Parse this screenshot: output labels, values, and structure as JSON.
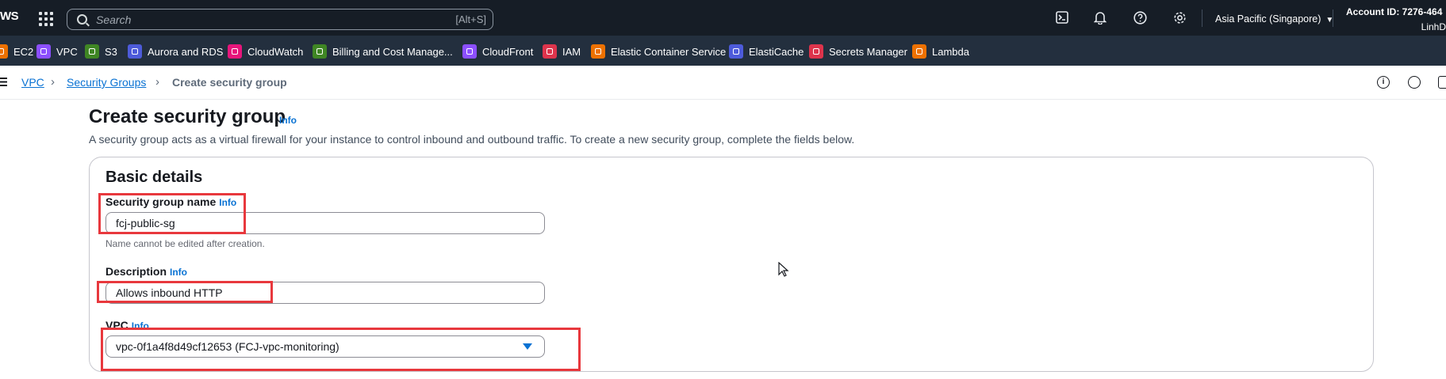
{
  "topnav": {
    "logo": "WS",
    "search_placeholder": "Search",
    "search_shortcut": "[Alt+S]",
    "region": "Asia Pacific (Singapore)",
    "account": "Account ID: 7276-464",
    "user": "LinhD"
  },
  "services": [
    {
      "label": "EC2",
      "color": "#ed7100"
    },
    {
      "label": "VPC",
      "color": "#8c4fff"
    },
    {
      "label": "S3",
      "color": "#3f8624"
    },
    {
      "label": "Aurora and RDS",
      "color": "#4d5bda"
    },
    {
      "label": "CloudWatch",
      "color": "#e7157b"
    },
    {
      "label": "Billing and Cost Manage...",
      "color": "#3f8624"
    },
    {
      "label": "CloudFront",
      "color": "#8c4fff"
    },
    {
      "label": "IAM",
      "color": "#dd344c"
    },
    {
      "label": "Elastic Container Service",
      "color": "#ed7100"
    },
    {
      "label": "ElastiCache",
      "color": "#4d5bda"
    },
    {
      "label": "Secrets Manager",
      "color": "#dd344c"
    },
    {
      "label": "Lambda",
      "color": "#ed7100"
    }
  ],
  "breadcrumb": {
    "items": [
      "VPC",
      "Security Groups"
    ],
    "current": "Create security group"
  },
  "page": {
    "title": "Create security group",
    "info": "Info",
    "description": "A security group acts as a virtual firewall for your instance to control inbound and outbound traffic. To create a new security group, complete the fields below."
  },
  "basic_details": {
    "title": "Basic details",
    "name_label": "Security group name",
    "name_value": "fcj-public-sg",
    "name_constraint": "Name cannot be edited after creation.",
    "description_label": "Description",
    "description_value": "Allows inbound HTTP",
    "vpc_label": "VPC",
    "vpc_value": "vpc-0f1a4f8d49cf12653 (FCJ-vpc-monitoring)"
  }
}
